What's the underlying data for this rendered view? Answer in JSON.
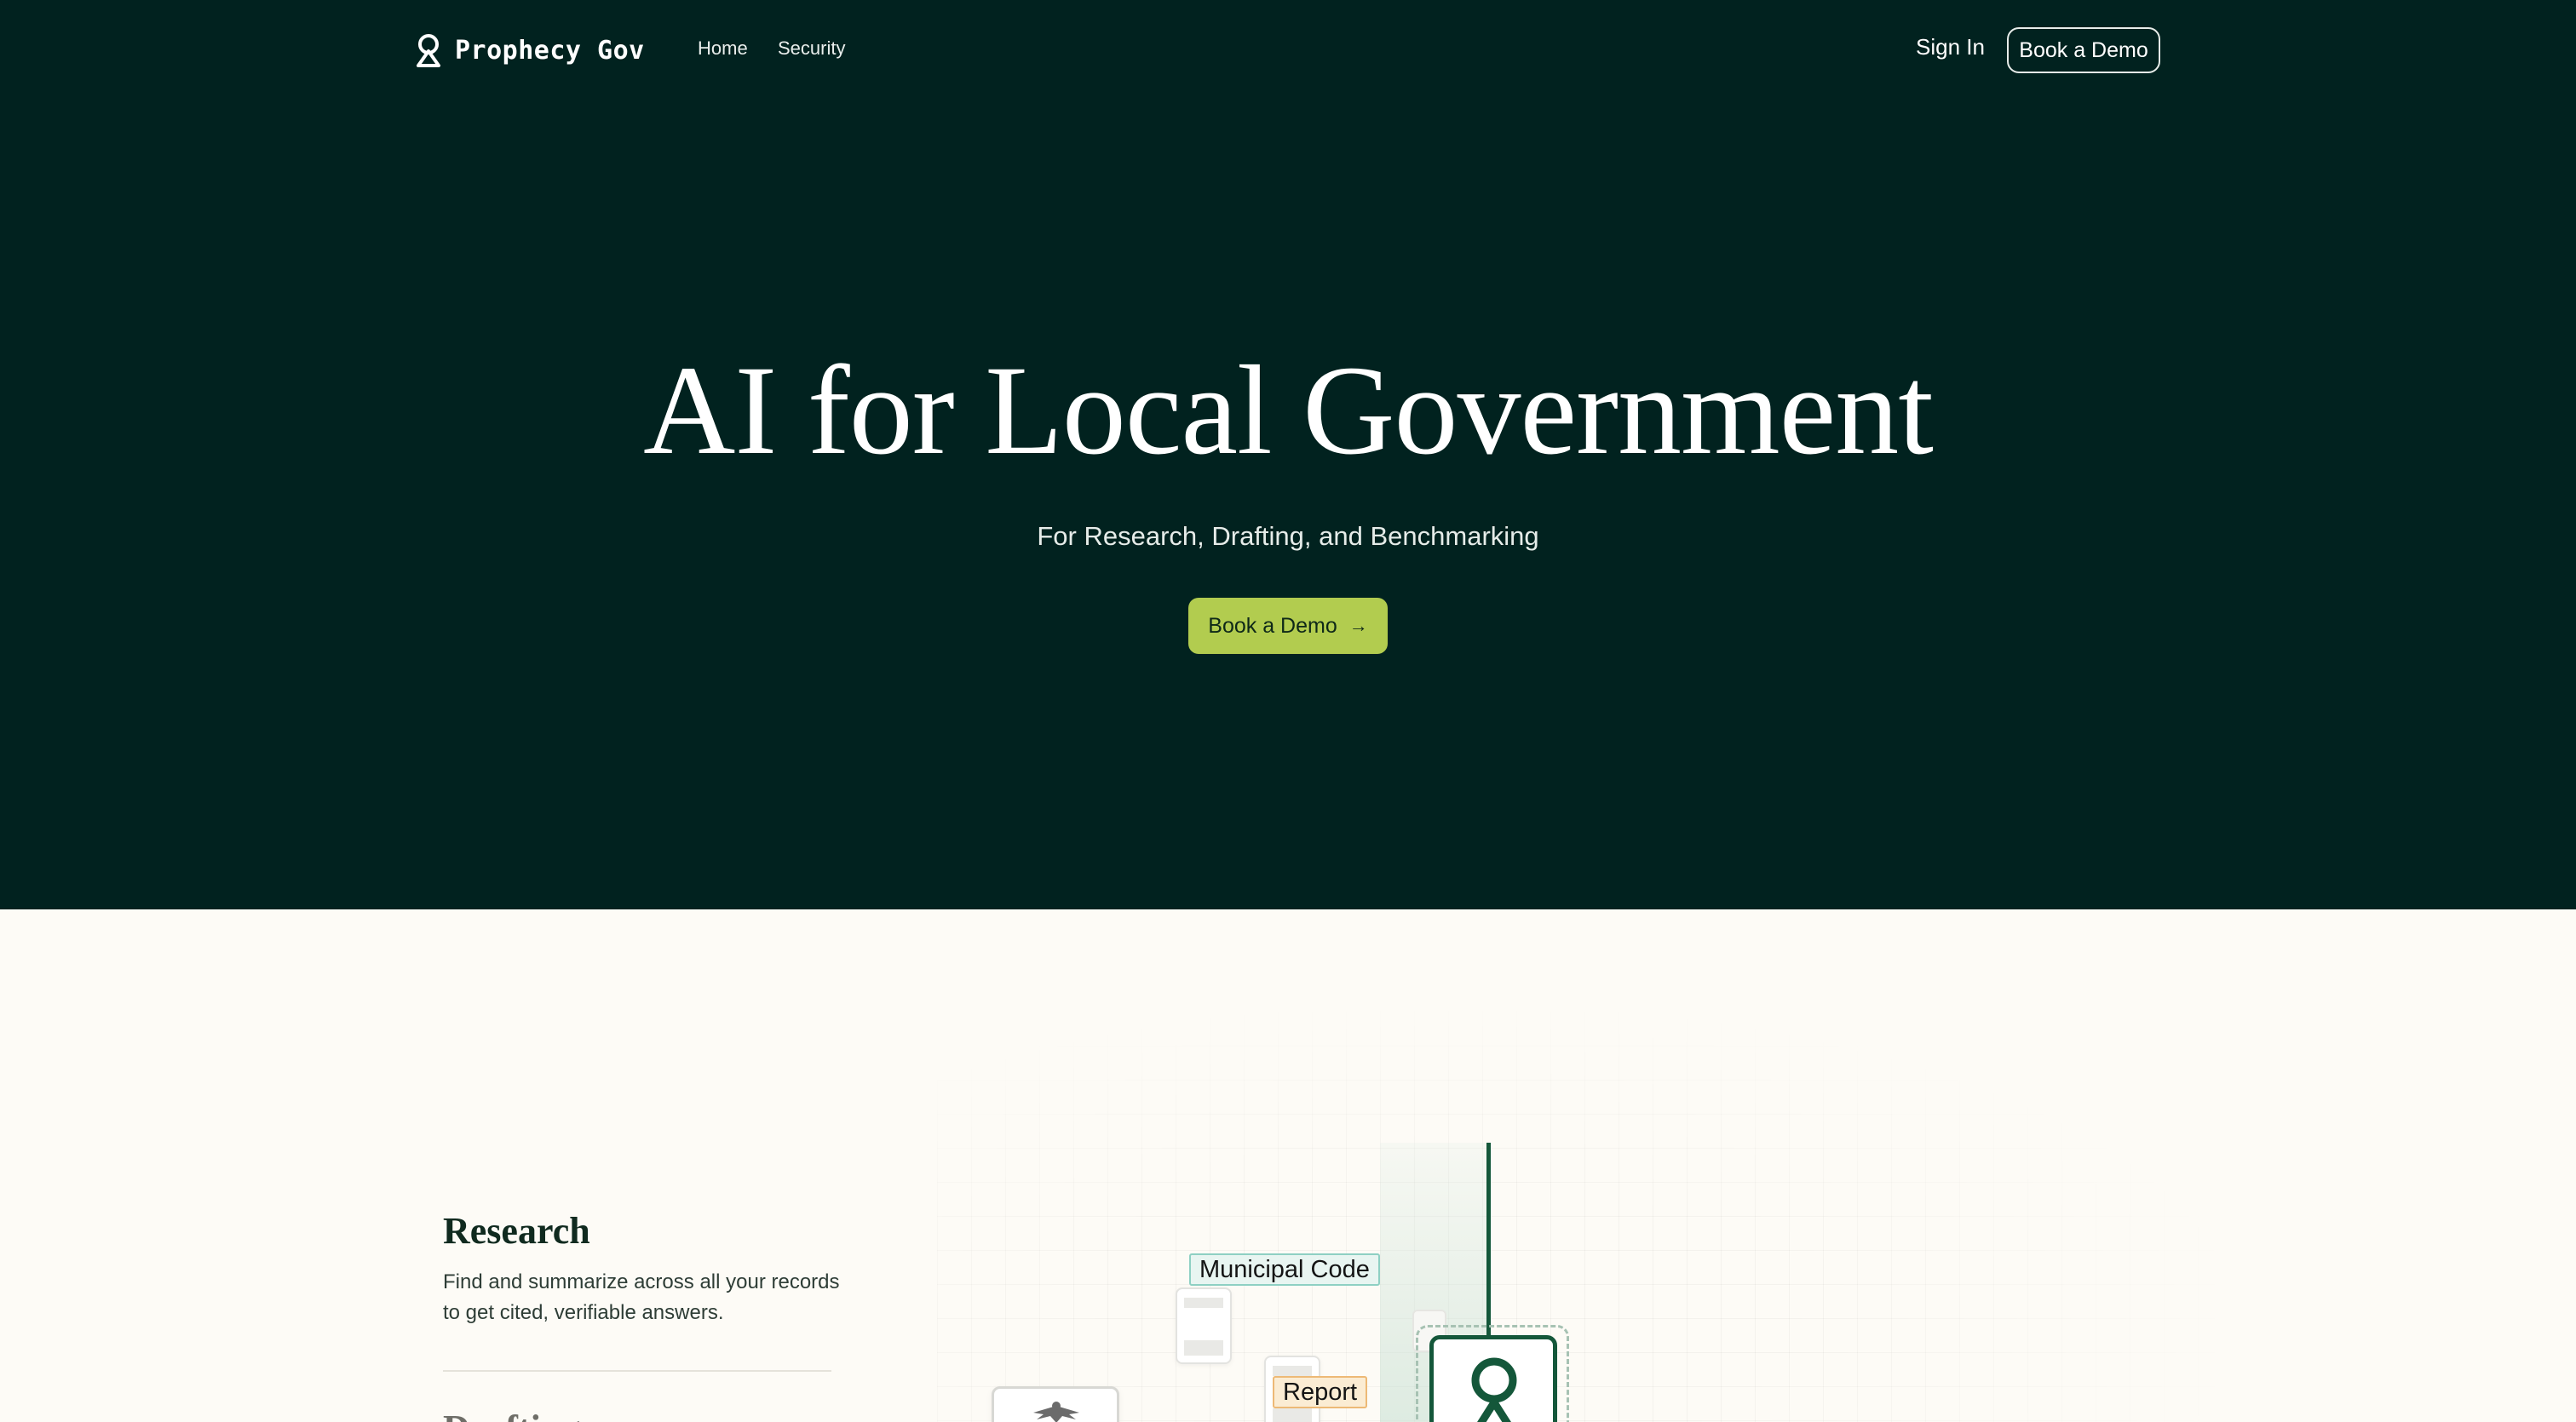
{
  "brand": {
    "name": "Prophecy Gov",
    "icon": "prophecy-logo-icon",
    "colors": {
      "hero_background": "#01221f",
      "cta_background": "#b2cc4f",
      "page_background": "#fdfbf6",
      "brand_green": "#14573a"
    }
  },
  "nav": {
    "links": [
      {
        "label": "Home"
      },
      {
        "label": "Security"
      }
    ],
    "sign_in": "Sign In",
    "demo_button": "Book a Demo"
  },
  "hero": {
    "title": "AI for Local Government",
    "subtitle": "For Research, Drafting, and Benchmarking",
    "cta_label": "Book a Demo",
    "cta_icon": "arrow-right-icon"
  },
  "features": {
    "active": {
      "title": "Research",
      "description": "Find and summarize across all your records to get cited, verifiable answers."
    },
    "next_title": "Drafting"
  },
  "illustration": {
    "tags": [
      {
        "label": "Municipal Code"
      },
      {
        "label": "Report"
      }
    ],
    "icons": [
      "document-icon",
      "eagle-seal-icon",
      "prophecy-logo-icon"
    ]
  }
}
